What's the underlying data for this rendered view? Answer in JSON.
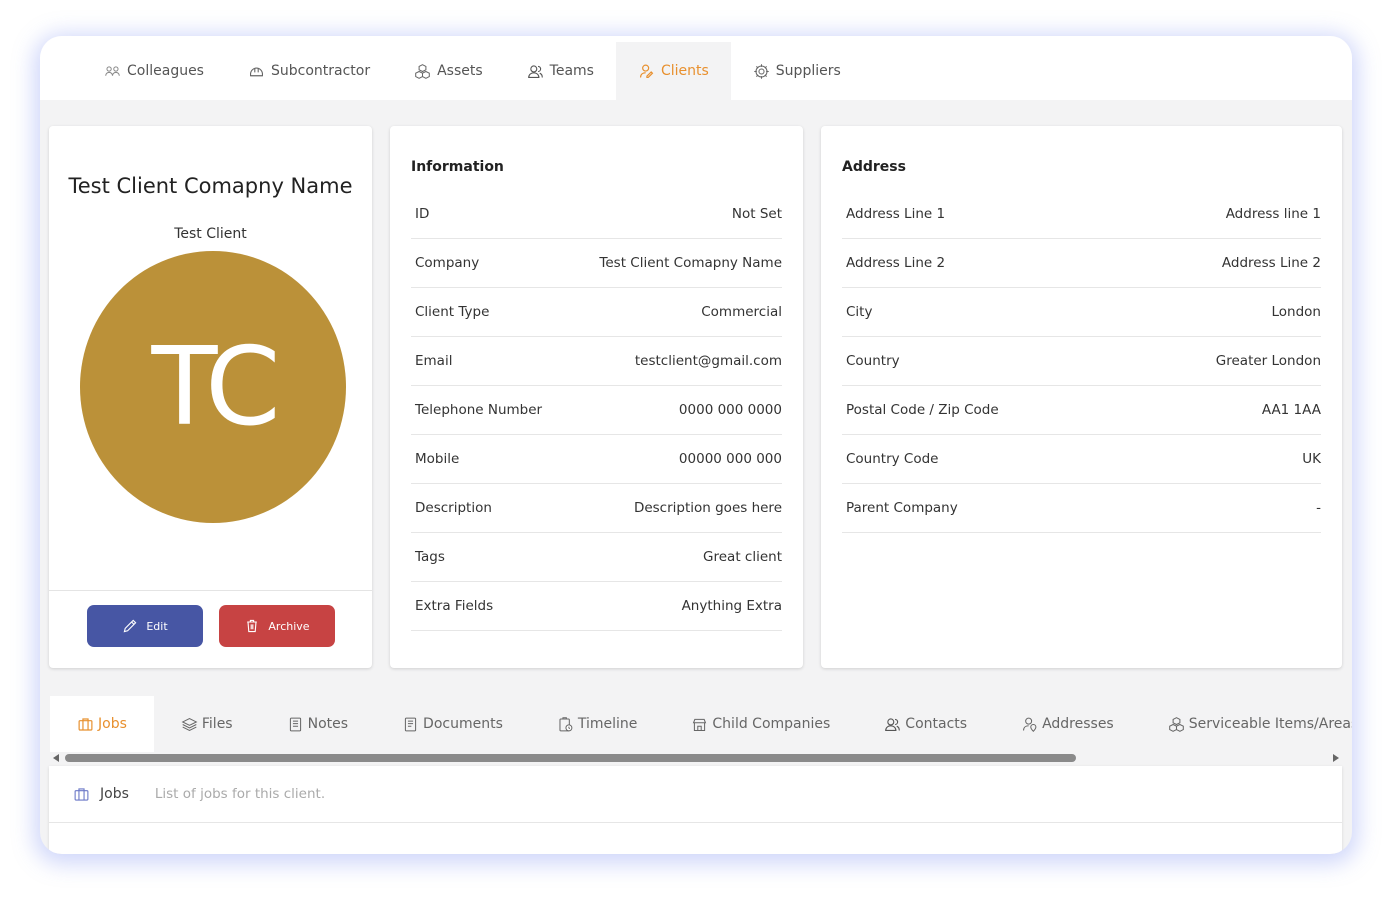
{
  "top_tabs": [
    {
      "label": "Colleagues",
      "icon": "users-icon"
    },
    {
      "label": "Subcontractor",
      "icon": "helmet-icon"
    },
    {
      "label": "Assets",
      "icon": "boxes-icon"
    },
    {
      "label": "Teams",
      "icon": "team-icon"
    },
    {
      "label": "Clients",
      "icon": "client-icon",
      "active": true
    },
    {
      "label": "Suppliers",
      "icon": "gear-icon"
    }
  ],
  "profile": {
    "name": "Test Client Comapny Name",
    "subtitle": "Test Client",
    "initials": "TC",
    "avatar_color": "#bb9139",
    "edit_label": "Edit",
    "archive_label": "Archive"
  },
  "information": {
    "title": "Information",
    "rows": [
      {
        "label": "ID",
        "value": "Not Set"
      },
      {
        "label": "Company",
        "value": "Test Client Comapny Name"
      },
      {
        "label": "Client Type",
        "value": "Commercial"
      },
      {
        "label": "Email",
        "value": "testclient@gmail.com"
      },
      {
        "label": "Telephone Number",
        "value": "0000 000 0000"
      },
      {
        "label": "Mobile",
        "value": "00000 000 000"
      },
      {
        "label": "Description",
        "value": "Description goes here"
      },
      {
        "label": "Tags",
        "value": "Great client"
      },
      {
        "label": "Extra Fields",
        "value": "Anything Extra"
      }
    ]
  },
  "address": {
    "title": "Address",
    "rows": [
      {
        "label": "Address Line 1",
        "value": "Address line 1"
      },
      {
        "label": "Address Line 2",
        "value": "Address Line 2"
      },
      {
        "label": "City",
        "value": "London"
      },
      {
        "label": "Country",
        "value": "Greater London"
      },
      {
        "label": "Postal Code / Zip Code",
        "value": "AA1 1AA"
      },
      {
        "label": "Country Code",
        "value": "UK"
      },
      {
        "label": "Parent Company",
        "value": "-"
      }
    ]
  },
  "sub_tabs": [
    {
      "label": "Jobs",
      "active": true
    },
    {
      "label": "Files"
    },
    {
      "label": "Notes"
    },
    {
      "label": "Documents"
    },
    {
      "label": "Timeline"
    },
    {
      "label": "Child Companies"
    },
    {
      "label": "Contacts"
    },
    {
      "label": "Addresses"
    },
    {
      "label": "Serviceable Items/Areas"
    }
  ],
  "jobs_panel": {
    "title": "Jobs",
    "description": "List of jobs for this client."
  },
  "colors": {
    "accent": "#e8902e",
    "edit": "#4756a4",
    "archive": "#c74343"
  }
}
